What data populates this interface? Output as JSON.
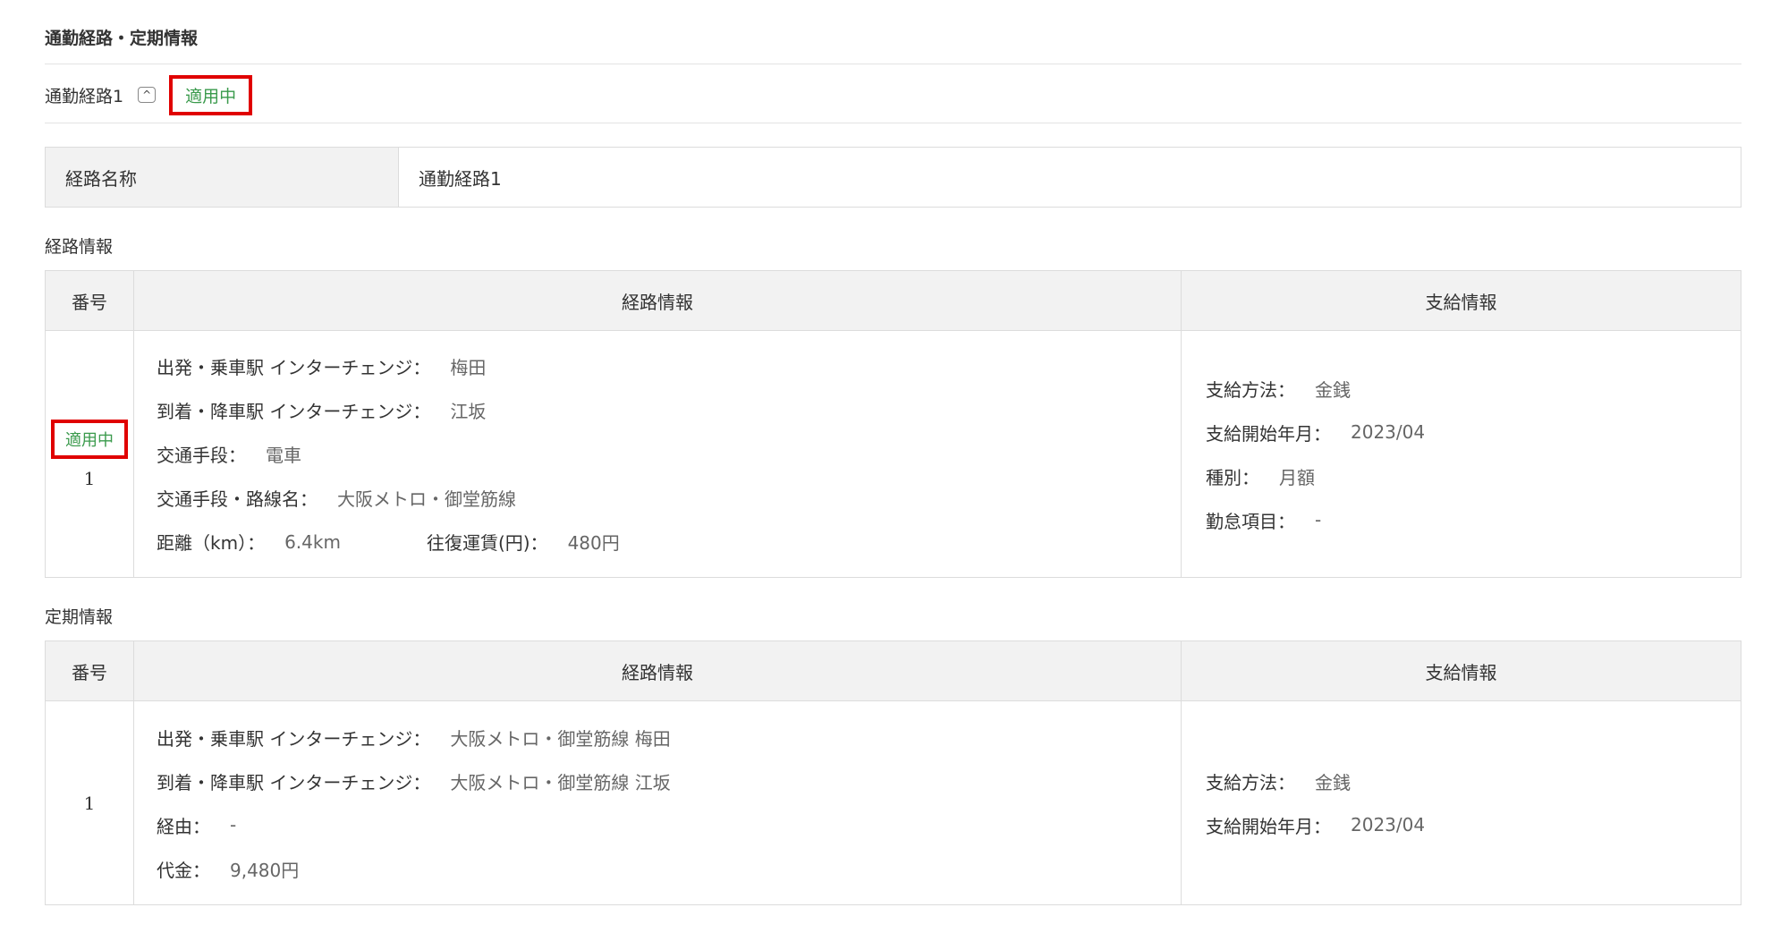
{
  "section_title": "通勤経路・定期情報",
  "route": {
    "name": "通勤経路1",
    "toggle_icon": "^",
    "status": "適用中"
  },
  "name_row": {
    "label": "経路名称",
    "value": "通勤経路1"
  },
  "route_info": {
    "title": "経路情報",
    "headers": {
      "no": "番号",
      "route": "経路情報",
      "pay": "支給情報"
    },
    "row": {
      "status": "適用中",
      "no": "1",
      "departure_label": "出発・乗車駅 インターチェンジ：",
      "departure": "梅田",
      "arrival_label": "到着・降車駅 インターチェンジ：",
      "arrival": "江坂",
      "means_label": "交通手段：",
      "means": "電車",
      "line_label": "交通手段・路線名：",
      "line": "大阪メトロ・御堂筋線",
      "distance_label": "距離（km）：",
      "distance": "6.4km",
      "fare_label": "往復運賃(円)：",
      "fare": "480円",
      "pay_method_label": "支給方法：",
      "pay_method": "金銭",
      "pay_start_label": "支給開始年月：",
      "pay_start": "2023/04",
      "type_label": "種別：",
      "type": "月額",
      "attendance_label": "勤怠項目：",
      "attendance": "-"
    }
  },
  "pass_info": {
    "title": "定期情報",
    "headers": {
      "no": "番号",
      "route": "経路情報",
      "pay": "支給情報"
    },
    "row": {
      "no": "1",
      "departure_label": "出発・乗車駅 インターチェンジ：",
      "departure": "大阪メトロ・御堂筋線 梅田",
      "arrival_label": "到着・降車駅 インターチェンジ：",
      "arrival": "大阪メトロ・御堂筋線 江坂",
      "via_label": "経由：",
      "via": "-",
      "price_label": "代金：",
      "price": "9,480円",
      "pay_method_label": "支給方法：",
      "pay_method": "金銭",
      "pay_start_label": "支給開始年月：",
      "pay_start": "2023/04"
    }
  }
}
